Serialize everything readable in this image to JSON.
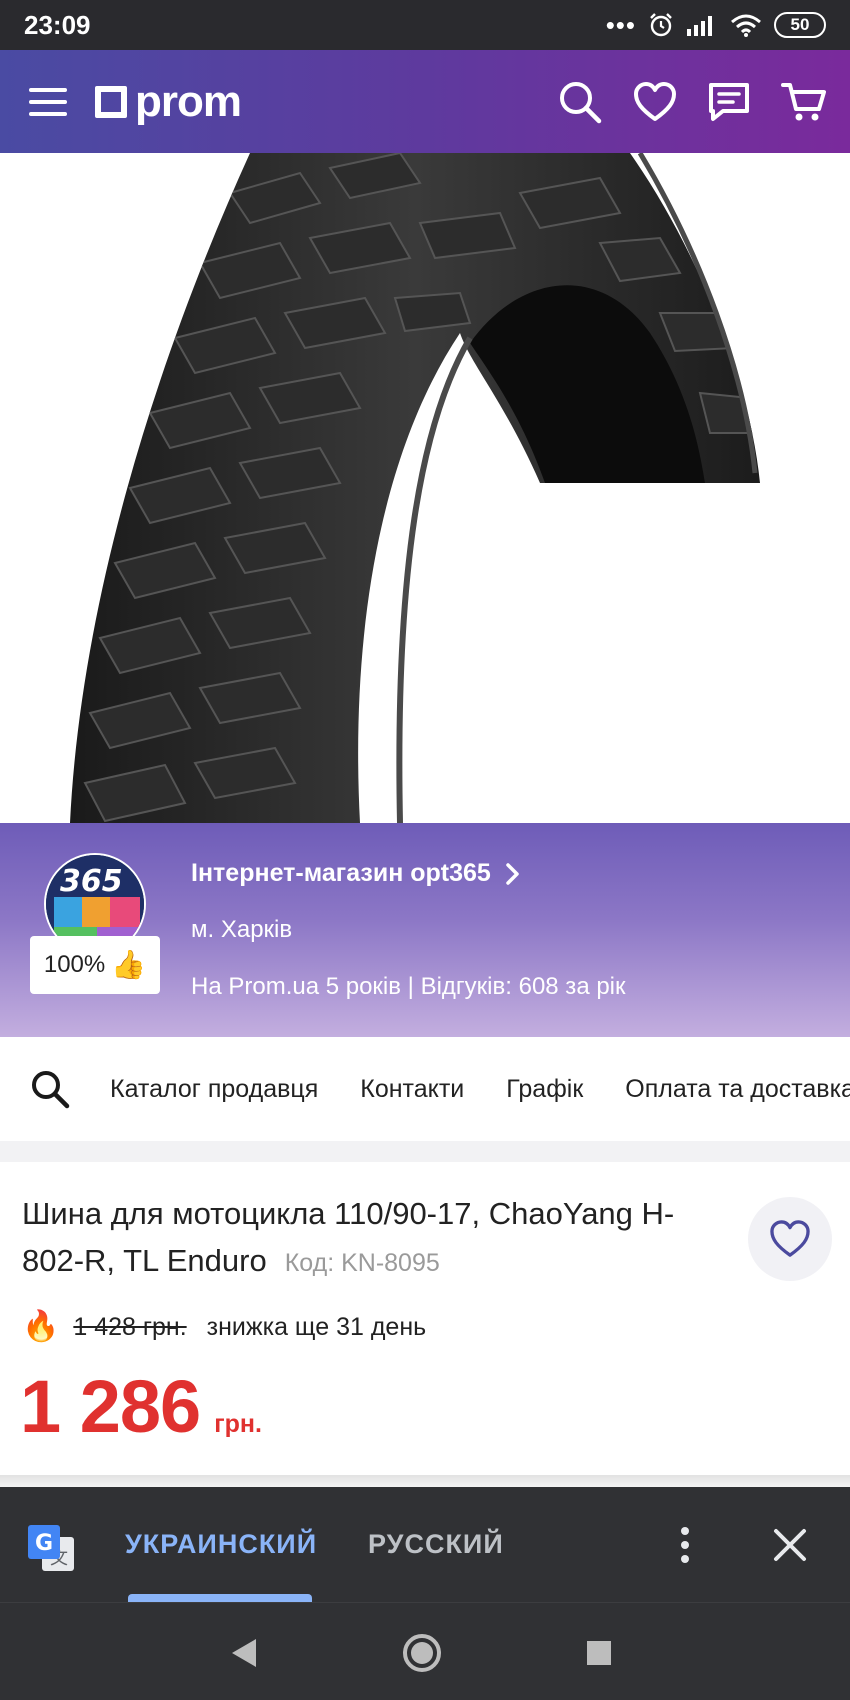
{
  "status_bar": {
    "time": "23:09",
    "dots": "•••",
    "battery": "50",
    "icons": [
      "alarm-icon",
      "signal-icon",
      "wifi-icon",
      "battery-icon"
    ]
  },
  "header": {
    "logo_text": "prom",
    "icons": [
      "menu-icon",
      "search-icon",
      "heart-icon",
      "chat-icon",
      "cart-icon"
    ],
    "gradient": [
      "#4a4ba3",
      "#7a2a9c"
    ]
  },
  "product_image": {
    "icon": "motorcycle-tire-image"
  },
  "seller": {
    "name": "Інтернет-магазин opt365",
    "city": "м. Харків",
    "stats": "На Prom.ua 5 років | Відгуків: 608 за рік",
    "rating": "100%",
    "rating_emoji": "👍",
    "avatar_text": "365"
  },
  "seller_nav": {
    "items": [
      "Каталог продавця",
      "Контакти",
      "Графік",
      "Оплата та доставка"
    ]
  },
  "product": {
    "title": "Шина для мотоцикла 110/90-17, ChaoYang H-802-R, TL Enduro",
    "code": "Код: KN-8095",
    "old_price": "1 428 грн.",
    "discount_note": "знижка ще 31 день",
    "fire_emoji": "🔥",
    "price": "1 286",
    "currency": "грн.",
    "price_color": "#e0312f"
  },
  "translate_bar": {
    "lang_active": "УКРАИНСКИЙ",
    "lang_other": "РУССКИЙ",
    "accent": "#8ab4f8"
  },
  "nav_bar": {
    "icons": [
      "back-icon",
      "home-icon",
      "recents-icon"
    ]
  }
}
